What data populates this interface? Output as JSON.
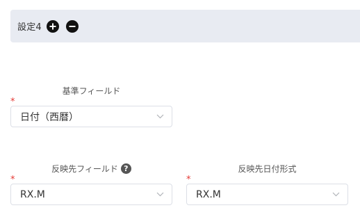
{
  "header": {
    "title": "設定4",
    "add_icon": "plus-circle-icon",
    "remove_icon": "minus-circle-icon"
  },
  "base_field": {
    "label": "基準フィールド",
    "required_mark": "*",
    "value": "日付（西暦）"
  },
  "target_field": {
    "label": "反映先フィールド",
    "required_mark": "*",
    "help_icon": "?",
    "value": "RX.M"
  },
  "target_date_format": {
    "label": "反映先日付形式",
    "required_mark": "*",
    "value": "RX.M"
  },
  "colors": {
    "header_bg": "#e8ebf2",
    "required": "#e53935",
    "border": "#dcdfe6"
  }
}
